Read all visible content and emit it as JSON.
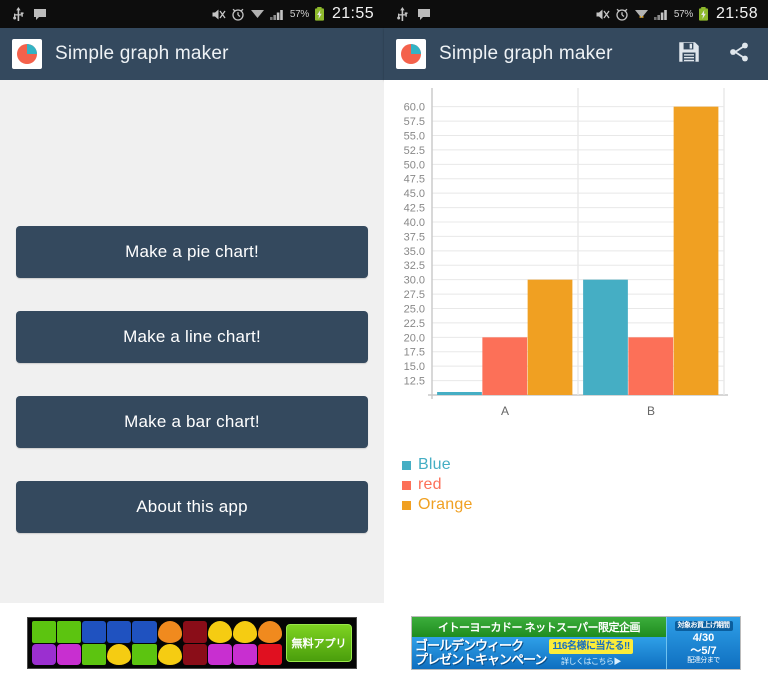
{
  "app": {
    "title": "Simple graph maker",
    "logo_icon": "pie-chart-logo",
    "toolbar_color": "#34495e"
  },
  "left_screen": {
    "statusbar": {
      "icons": [
        "usb-icon",
        "message-icon"
      ],
      "right_icons": [
        "mute-icon",
        "alarm-icon",
        "wifi-icon",
        "signal-icon"
      ],
      "battery_percent": "57%",
      "battery_icon": "battery-charging-icon",
      "time": "21:55"
    },
    "menu": {
      "buttons": [
        {
          "label": "Make a pie chart!",
          "name": "make-pie-chart-button"
        },
        {
          "label": "Make a line chart!",
          "name": "make-line-chart-button"
        },
        {
          "label": "Make a bar chart!",
          "name": "make-bar-chart-button"
        },
        {
          "label": "About this app",
          "name": "about-this-app-button"
        }
      ]
    },
    "ad": {
      "type": "candy-crush-banner",
      "cta_label": "無料アプリ"
    }
  },
  "right_screen": {
    "statusbar": {
      "icons": [
        "usb-icon",
        "message-icon"
      ],
      "right_icons": [
        "mute-icon",
        "alarm-icon",
        "wifi-download-icon",
        "signal-icon"
      ],
      "battery_percent": "57%",
      "battery_icon": "battery-charging-icon",
      "time": "21:58"
    },
    "toolbar_actions": [
      {
        "name": "save-button",
        "icon": "floppy-disk-icon"
      },
      {
        "name": "share-button",
        "icon": "share-icon"
      }
    ],
    "ad": {
      "type": "ito-yokado-banner",
      "headline": "イトーヨーカドー ネットスーパー限定企画",
      "title_line1": "ゴールデンウィーク",
      "title_line2": "プレゼントキャンペーン",
      "highlight": "116名様に当たる!!",
      "link": "詳しくはこちら▶",
      "side_badge": "対象お買上げ期間",
      "side_date1": "4/30",
      "side_date2": "～5/7",
      "side_note": "配達分まで"
    }
  },
  "chart_data": {
    "type": "bar",
    "title": "",
    "xlabel": "",
    "ylabel": "",
    "categories": [
      "A",
      "B"
    ],
    "series": [
      {
        "name": "Blue",
        "color": "#45aec4",
        "values": [
          0,
          30
        ]
      },
      {
        "name": "red",
        "color": "#fc7058",
        "values": [
          20,
          20
        ]
      },
      {
        "name": "Orange",
        "color": "#f0a022",
        "values": [
          30,
          60
        ]
      }
    ],
    "ylim": [
      10,
      61.5
    ],
    "yticks": [
      12.5,
      15.0,
      17.5,
      20.0,
      22.5,
      25.0,
      27.5,
      30.0,
      32.5,
      35.0,
      37.5,
      40.0,
      42.5,
      45.0,
      47.5,
      50.0,
      52.5,
      55.0,
      57.5,
      60.0
    ],
    "ytick_labels": [
      "12.5",
      "15.0",
      "17.5",
      "20.0",
      "22.5",
      "25.0",
      "27.5",
      "30.0",
      "32.5",
      "35.0",
      "37.5",
      "40.0",
      "42.5",
      "45.0",
      "47.5",
      "50.0",
      "52.5",
      "55.0",
      "57.5",
      "60.0"
    ],
    "grid": true,
    "legend_position": "below-left",
    "legend": [
      "Blue",
      "red",
      "Orange"
    ],
    "axis_color": "#c8c8c8",
    "grid_color": "#e8e8e8",
    "tick_text_color": "#888888"
  }
}
